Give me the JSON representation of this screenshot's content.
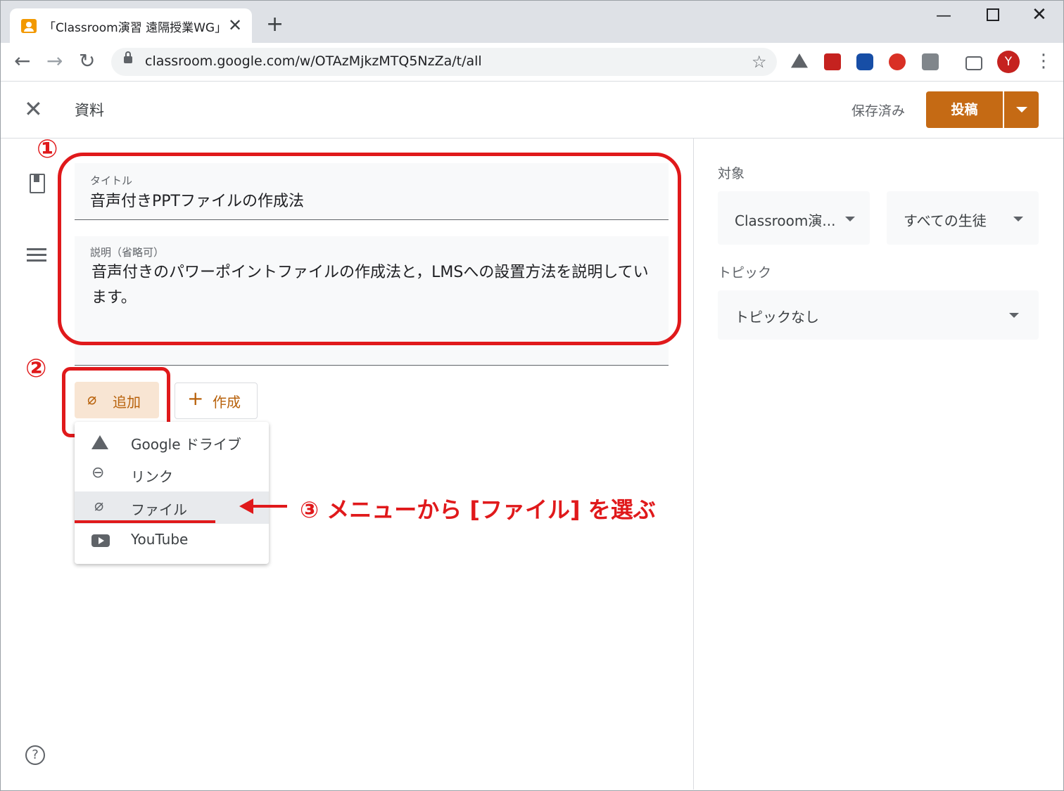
{
  "browser": {
    "tab_title": "「Classroom演習 遠隔授業WG」の",
    "url": "classroom.google.com/w/OTAzMjkzMTQ5NzZa/t/all",
    "avatar_letter": "Y"
  },
  "header": {
    "title": "資料",
    "saved_status": "保存済み",
    "post_label": "投稿"
  },
  "form": {
    "title_label": "タイトル",
    "title_value": "音声付きPPTファイルの作成法",
    "desc_label": "説明（省略可）",
    "desc_value": "音声付きのパワーポイントファイルの作成法と，LMSへの設置方法を説明しています。",
    "add_label": "追加",
    "create_label": "作成"
  },
  "add_menu": {
    "items": [
      {
        "label": "Google ドライブ",
        "icon": "drive-icon"
      },
      {
        "label": "リンク",
        "icon": "link-icon"
      },
      {
        "label": "ファイル",
        "icon": "paperclip-icon"
      },
      {
        "label": "YouTube",
        "icon": "youtube-icon"
      }
    ]
  },
  "annotations": {
    "n1": "①",
    "n2": "②",
    "n3": "③ メニューから [ファイル] を選ぶ"
  },
  "sidebar": {
    "target_label": "対象",
    "class_select": "Classroom演...",
    "students_select": "すべての生徒",
    "topic_label": "トピック",
    "topic_select": "トピックなし"
  },
  "colors": {
    "accent": "#c56a14",
    "annotation_red": "#e0191b"
  }
}
